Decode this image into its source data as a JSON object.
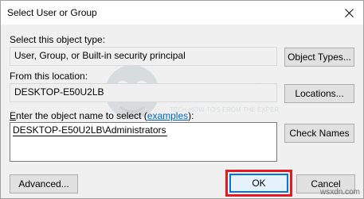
{
  "window": {
    "title": "Select User or Group",
    "close_icon": "close-icon"
  },
  "object_type": {
    "label": "Select this object type:",
    "value": "User, Group, or Built-in security principal",
    "button_label": "Object Types..."
  },
  "location": {
    "label": "From this location:",
    "value": "DESKTOP-E50U2LB",
    "button_label": "Locations..."
  },
  "object_names": {
    "label_prefix": "nter the object name to select (",
    "label_access_key": "E",
    "link_text": "examples",
    "label_suffix": "):",
    "value": "DESKTOP-E50U2LB\\Administrators",
    "button_label": "Check Names"
  },
  "footer": {
    "advanced_label": "Advanced...",
    "ok_label": "OK",
    "cancel_label": "Cancel"
  },
  "watermark": {
    "brand": "APPUALS",
    "tagline": "TECH HOW-TO'S FROM THE EXPERTS!",
    "site": "wsxdn.com"
  },
  "colors": {
    "highlight": "#e21a22",
    "focus_border": "#0078d7",
    "link": "#0066cc"
  }
}
